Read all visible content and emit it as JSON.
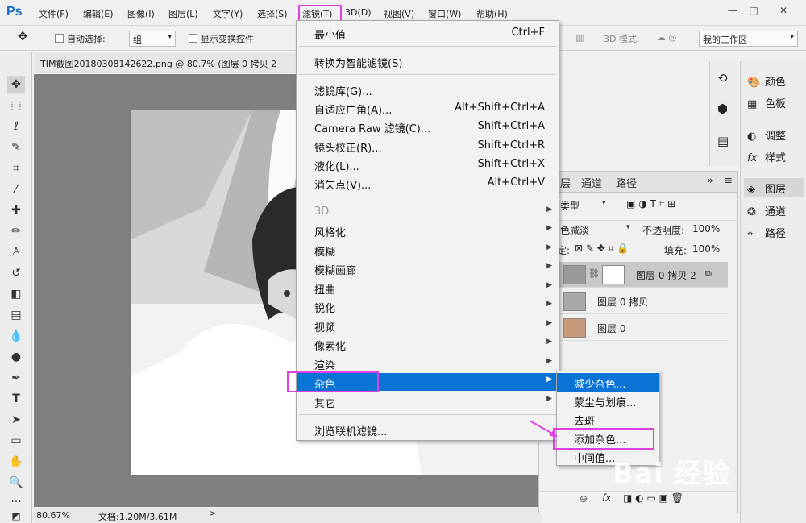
{
  "app": {
    "logo": "Ps"
  },
  "menubar": {
    "items": [
      "文件(F)",
      "编辑(E)",
      "图像(I)",
      "图层(L)",
      "文字(Y)",
      "选择(S)",
      "滤镜(T)",
      "3D(D)",
      "视图(V)",
      "窗口(W)",
      "帮助(H)"
    ],
    "window_controls": [
      "—",
      "□",
      "✕"
    ]
  },
  "options_bar": {
    "auto_select_label": "自动选择:",
    "auto_select_value": "组",
    "show_transform_label": "显示变换控件",
    "mode_3d_label": "3D 模式:",
    "workspace": "我的工作区"
  },
  "document": {
    "tab_title": "TIM截图20180308142622.png @ 80.7% (图层 0 拷贝 2",
    "zoom": "80.67%",
    "doc_info": "文档:1.20M/3.61M"
  },
  "filter_menu": {
    "items": [
      {
        "label": "最小值",
        "shortcut": "Ctrl+F"
      },
      {
        "label": "转换为智能滤镜(S)"
      },
      {
        "label": "滤镜库(G)..."
      },
      {
        "label": "自适应广角(A)...",
        "shortcut": "Alt+Shift+Ctrl+A"
      },
      {
        "label": "Camera Raw 滤镜(C)...",
        "shortcut": "Shift+Ctrl+A"
      },
      {
        "label": "镜头校正(R)...",
        "shortcut": "Shift+Ctrl+R"
      },
      {
        "label": "液化(L)...",
        "shortcut": "Shift+Ctrl+X"
      },
      {
        "label": "消失点(V)...",
        "shortcut": "Alt+Ctrl+V"
      },
      {
        "label": "3D"
      },
      {
        "label": "风格化"
      },
      {
        "label": "模糊"
      },
      {
        "label": "模糊画廊"
      },
      {
        "label": "扭曲"
      },
      {
        "label": "锐化"
      },
      {
        "label": "视频"
      },
      {
        "label": "像素化"
      },
      {
        "label": "渲染"
      },
      {
        "label": "杂色"
      },
      {
        "label": "其它"
      },
      {
        "label": "浏览联机滤镜..."
      }
    ]
  },
  "noise_submenu": {
    "items": [
      "减少杂色...",
      "蒙尘与划痕...",
      "去斑",
      "添加杂色...",
      "中间值..."
    ]
  },
  "layers_panel": {
    "tabs": [
      "层",
      "通道",
      "路径"
    ],
    "filter_kind": "类型",
    "blend_mode": "色减淡",
    "opacity_label": "不透明度:",
    "opacity_value": "100%",
    "lock_label": "定:",
    "fill_label": "填充:",
    "fill_value": "100%",
    "layers": [
      {
        "name": "图层 0 拷贝 2",
        "selected": true
      },
      {
        "name": "图层 0 拷贝",
        "selected": false
      },
      {
        "name": "图层 0",
        "selected": false
      }
    ]
  },
  "right_panel": {
    "items": [
      {
        "icon": "palette-icon",
        "glyph": "🎨",
        "label": "颜色"
      },
      {
        "icon": "swatches-icon",
        "glyph": "▦",
        "label": "色板"
      },
      {
        "icon": "adjustments-icon",
        "glyph": "◐",
        "label": "调整"
      },
      {
        "icon": "styles-icon",
        "glyph": "fx",
        "label": "样式"
      },
      {
        "icon": "layers-icon",
        "glyph": "◈",
        "label": "图层"
      },
      {
        "icon": "channels-icon",
        "glyph": "❂",
        "label": "通道"
      },
      {
        "icon": "paths-icon",
        "glyph": "⌖",
        "label": "路径"
      }
    ]
  },
  "watermark": "Bai 经验",
  "colors": {
    "highlight": "#0a73d6",
    "annotation": "#e040e0"
  }
}
